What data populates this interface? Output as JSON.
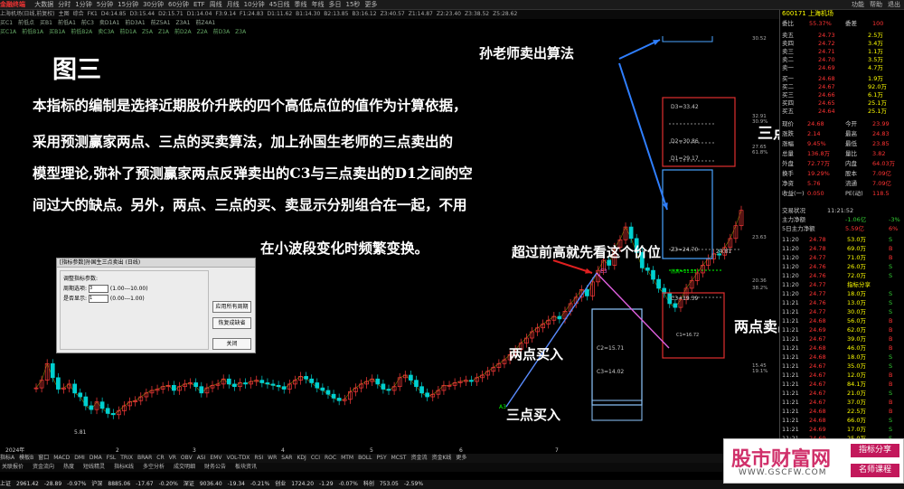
{
  "menu": {
    "logo": "金融终端",
    "items": [
      "大数据",
      "分时",
      "1分钟",
      "5分钟",
      "15分钟",
      "30分钟",
      "60分钟",
      "ETF",
      "周线",
      "月线",
      "10分钟",
      "45日线",
      "季线",
      "年线",
      "多日",
      "15秒",
      "更多"
    ],
    "window_buttons": [
      "功能",
      "帮助",
      "退出"
    ]
  },
  "toolbar": {
    "items": [
      "上海机场(日线,前复权)",
      "主图",
      "综合",
      "FK1",
      "D4:14.85",
      "D3:15.44",
      "D2:15.71",
      "D1:14.04",
      "F3:9.14",
      "F1:24.83",
      "D1:11.62",
      "B1:14.30",
      "B2:13.85",
      "B3:16.12",
      "Z3:40.57",
      "Z1:14.87",
      "Z2:23.40",
      "Z3:38.52",
      "Z5:28.62"
    ],
    "row2": [
      "买C1",
      "前低点",
      "买B1",
      "前低A1",
      "前C3",
      "卖D1A1",
      "前D3A1",
      "前Z5A1",
      "Z3A1",
      "前Z4A1"
    ],
    "row3": [
      "买C1A",
      "前低B1A",
      "买B1A",
      "前低B2A",
      "卖C3A",
      "前D1A",
      "Z5A",
      "Z1A",
      "前D2A",
      "Z2A",
      "前D3A",
      "Z3A"
    ]
  },
  "annotations": {
    "title": "图三",
    "para1": "本指标的编制是选择近期股价升跌的四个高低点位的值作为计算依据，",
    "para2": "采用预测赢家两点、三点的买卖算法，加上孙国生老师的三点卖出的",
    "para3": "模型理论,弥补了预测赢家两点反弹卖出的C3与三点卖出的D1之间的空",
    "para4": "间过大的缺点。另外，两点、三点的买、卖显示分别组合在一起，不用",
    "para5": "在小波段变化时频繁变换。",
    "sun_label": "孙老师卖出算法",
    "three_sell": "三点卖出",
    "two_sell": "两点卖出",
    "prior_high": "超过前高就先看这个价位",
    "two_buy": "两点买入",
    "three_buy": "三点买入"
  },
  "chart_labels": {
    "d3": "D3=33.42",
    "d2": "D2=30.86",
    "d1": "D1=29.17",
    "z3": "Z3=24.70",
    "c3": "C3=19.39",
    "c2": "C2=15.71",
    "c3b": "C3=14.02",
    "e3": "E3",
    "a3": "A3",
    "prev_high": "前高=21.23",
    "price_24": "24.81",
    "c_small": "C1=16.72",
    "low_label": "5.81",
    "year_label": "2024年",
    "month_labels": [
      "2",
      "3",
      "4",
      "5",
      "6",
      "7"
    ],
    "axis": [
      "30.52",
      "32.91",
      "30.9%",
      "27.65",
      "61.8%",
      "23.63",
      "20.36",
      "38.2%",
      "15.45",
      "19.1%"
    ]
  },
  "dialog": {
    "title": "[指标参数]孙国生三点卖出 (日线)",
    "group": "调整指标参数:",
    "param1_label": "周期选项:",
    "param1_value": "3",
    "param1_range": "(1.00---10.00)",
    "param2_label": "是否显示:",
    "param2_value": "1",
    "param2_range": "(0.00---1.00)",
    "btn_apply": "应用所有周期",
    "btn_default": "恢复成缺省",
    "btn_close": "关闭"
  },
  "quote": {
    "code": "600171 上海机场",
    "header_left": "委比",
    "header_pct": "55.37%",
    "header_right": "委差",
    "header_val": "100",
    "asks": [
      {
        "label": "卖五",
        "price": "24.73",
        "vol": "2.5万"
      },
      {
        "label": "卖四",
        "price": "24.72",
        "vol": "3.4万"
      },
      {
        "label": "卖三",
        "price": "24.71",
        "vol": "1.1万"
      },
      {
        "label": "卖二",
        "price": "24.70",
        "vol": "3.5万"
      },
      {
        "label": "卖一",
        "price": "24.69",
        "vol": "4.7万"
      }
    ],
    "bids": [
      {
        "label": "买一",
        "price": "24.68",
        "vol": "1.9万"
      },
      {
        "label": "买二",
        "price": "24.67",
        "vol": "92.0万"
      },
      {
        "label": "买三",
        "price": "24.66",
        "vol": "6.1万"
      },
      {
        "label": "买四",
        "price": "24.65",
        "vol": "25.1万"
      },
      {
        "label": "买五",
        "price": "24.64",
        "vol": "25.1万"
      }
    ],
    "stats": [
      {
        "l": "现价",
        "v": "24.68",
        "l2": "今开",
        "v2": "23.99"
      },
      {
        "l": "涨跌",
        "v": "2.14",
        "l2": "最高",
        "v2": "24.83"
      },
      {
        "l": "涨幅",
        "v": "9.45%",
        "l2": "最低",
        "v2": "23.85"
      },
      {
        "l": "总量",
        "v": "136.8万",
        "l2": "量比",
        "v2": "3.82"
      },
      {
        "l": "外盘",
        "v": "72.77万",
        "l2": "内盘",
        "v2": "64.03万"
      },
      {
        "l": "换手",
        "v": "19.29%",
        "l2": "股本",
        "v2": "7.09亿"
      },
      {
        "l": "净资",
        "v": "5.76",
        "l2": "流通",
        "v2": "7.09亿"
      },
      {
        "l": "收益(一)",
        "v": "0.050",
        "l2": "PE(动)",
        "v2": "118.5"
      }
    ],
    "time_label": "交易状况",
    "time_val": "11:21:52",
    "flow1_label": "主力净额",
    "flow1_val": "-1.06亿",
    "flow1_pct": "-3%",
    "flow2_label": "5日主力净额",
    "flow2_val": "5.59亿",
    "flow2_pct": "6%",
    "trades": [
      {
        "t": "11:20",
        "p": "24.78",
        "v": "53.0万",
        "s": "S"
      },
      {
        "t": "11:20",
        "p": "24.78",
        "v": "69.0万",
        "s": "B"
      },
      {
        "t": "11:20",
        "p": "24.77",
        "v": "71.0万",
        "s": "B"
      },
      {
        "t": "11:20",
        "p": "24.76",
        "v": "26.0万",
        "s": "S"
      },
      {
        "t": "11:20",
        "p": "24.76",
        "v": "72.0万",
        "s": "S"
      },
      {
        "t": "11:20",
        "p": "24.77",
        "v": "指标分享",
        "s": ""
      },
      {
        "t": "11:20",
        "p": "24.77",
        "v": "18.0万",
        "s": "S"
      },
      {
        "t": "11:21",
        "p": "24.76",
        "v": "13.0万",
        "s": "S"
      },
      {
        "t": "11:21",
        "p": "24.77",
        "v": "30.0万",
        "s": "S"
      },
      {
        "t": "11:21",
        "p": "24.68",
        "v": "56.0万",
        "s": "B"
      },
      {
        "t": "11:21",
        "p": "24.69",
        "v": "62.0万",
        "s": "B"
      },
      {
        "t": "11:21",
        "p": "24.67",
        "v": "39.0万",
        "s": "B"
      },
      {
        "t": "11:21",
        "p": "24.68",
        "v": "46.0万",
        "s": "B"
      },
      {
        "t": "11:21",
        "p": "24.68",
        "v": "18.0万",
        "s": "S"
      },
      {
        "t": "11:21",
        "p": "24.67",
        "v": "35.0万",
        "s": "S"
      },
      {
        "t": "11:21",
        "p": "24.67",
        "v": "12.0万",
        "s": "B"
      },
      {
        "t": "11:21",
        "p": "24.67",
        "v": "84.1万",
        "s": "B"
      },
      {
        "t": "11:21",
        "p": "24.67",
        "v": "21.0万",
        "s": "S"
      },
      {
        "t": "11:21",
        "p": "24.67",
        "v": "37.0万",
        "s": "B"
      },
      {
        "t": "11:21",
        "p": "24.68",
        "v": "22.5万",
        "s": "B"
      },
      {
        "t": "11:21",
        "p": "24.68",
        "v": "66.0万",
        "s": "S"
      },
      {
        "t": "11:21",
        "p": "24.69",
        "v": "17.0万",
        "s": "S"
      },
      {
        "t": "11:21",
        "p": "24.69",
        "v": "25.0万",
        "s": "S"
      },
      {
        "t": "11:21",
        "p": "24.68",
        "v": "32.0万",
        "s": "B"
      }
    ]
  },
  "indicator_tabs": [
    "指标A",
    "模板B",
    "窗口",
    "MACD",
    "DMI",
    "DMA",
    "FSL",
    "TRIX",
    "BRAR",
    "CR",
    "VR",
    "OBV",
    "ASI",
    "EMV",
    "VOL-TDX",
    "RSI",
    "WR",
    "SAR",
    "KDJ",
    "CCI",
    "ROC",
    "MTM",
    "BOLL",
    "PSY",
    "MCST",
    "资金流",
    "资金K线",
    "更多"
  ],
  "bottom_tabs": [
    "关联报价",
    "资金流向",
    "热度",
    "短线精灵",
    "指标K线",
    "多空分析",
    "成交明细",
    "财务公告",
    "板块资讯"
  ],
  "status": [
    "上证",
    "2961.42",
    "-28.89",
    "-0.97%",
    "沪深",
    "8885.06",
    "-17.67",
    "-0.20%",
    "深证",
    "9036.40",
    "-19.34",
    "-0.21%",
    "创业",
    "1724.20",
    "-1.29",
    "-0.07%",
    "科创",
    "753.05",
    "-2.59%"
  ],
  "watermark": {
    "title": "股市财富网",
    "url": "WWW.GSCFW.COM",
    "tag1": "指标分享",
    "tag2": "名师课程"
  },
  "chart_data": {
    "type": "candlestick",
    "series": [
      {
        "values": [
          8.6,
          9.2,
          10.5,
          9.4,
          8.5,
          8.6,
          8.9,
          8.2,
          7.9,
          7.2,
          6.9,
          7.5,
          7.0,
          6.6,
          6.5,
          6.8,
          7.2,
          7.5,
          7.6,
          7.9,
          8.2,
          8.4,
          8.5,
          8.7,
          8.8,
          8.4,
          8.7,
          8.9,
          9.0,
          8.7,
          8.2,
          8.6,
          8.8,
          8.9,
          9.3,
          8.9,
          8.7,
          9.0,
          8.9,
          9.1,
          9.2,
          9.0,
          8.9,
          8.8,
          8.7,
          8.5,
          8.9,
          9.2,
          9.5,
          9.3,
          9.0,
          8.6,
          8.4,
          8.1,
          7.8,
          7.6,
          7.7,
          8.3,
          8.6,
          8.9,
          9.1,
          9.3,
          8.9,
          8.5,
          8.4,
          8.7,
          9.4,
          9.6,
          9.2,
          8.7,
          8.2,
          7.9,
          8.1,
          8.4,
          8.8,
          8.8,
          9.0,
          9.1,
          9.2,
          9.1,
          9.4,
          9.6,
          9.9,
          10.2,
          10.5,
          10.8,
          11.2,
          11.6,
          12.1,
          12.5,
          13.0,
          13.3,
          13.6,
          13.9,
          14.2,
          14.0,
          14.6,
          15.2,
          15.7,
          16.3,
          15.8,
          16.9,
          17.8,
          18.6,
          18.2,
          19.6,
          20.2,
          21.2,
          20.3,
          19.2,
          18.0,
          17.8,
          17.1,
          16.4,
          16.0,
          15.2,
          14.9,
          15.5,
          16.4,
          17.0,
          17.6,
          18.2,
          18.7,
          19.1,
          19.0,
          19.6,
          20.3,
          21.3,
          22.5
        ]
      }
    ],
    "ylabel": "",
    "ylim": [
      5,
      36
    ]
  }
}
